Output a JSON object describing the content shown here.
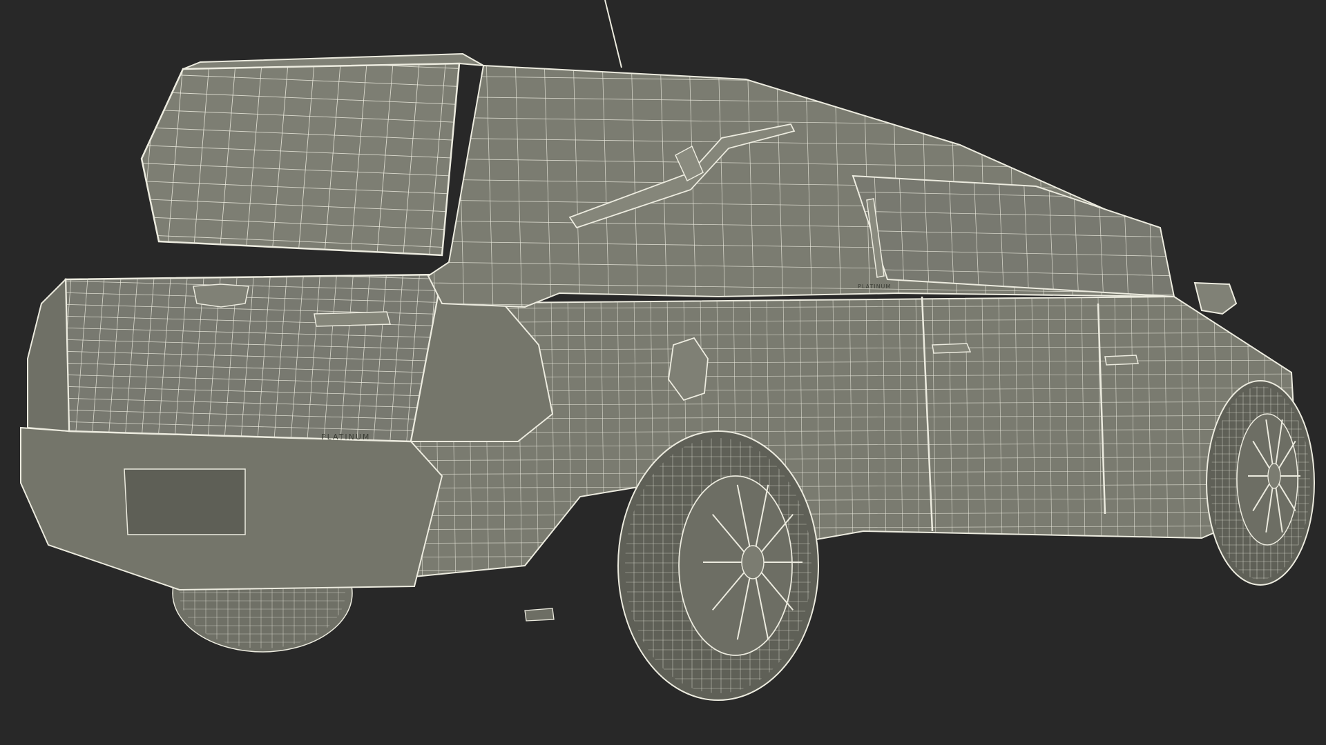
{
  "scene": {
    "background_color": "#282828",
    "surface_color": "#7a7b70",
    "surface_shadow_color": "#5e5f56",
    "wire_color": "#ecebdf"
  },
  "badges": {
    "rear_badge": "PLATINUM",
    "side_badge": "PLATINUM"
  }
}
